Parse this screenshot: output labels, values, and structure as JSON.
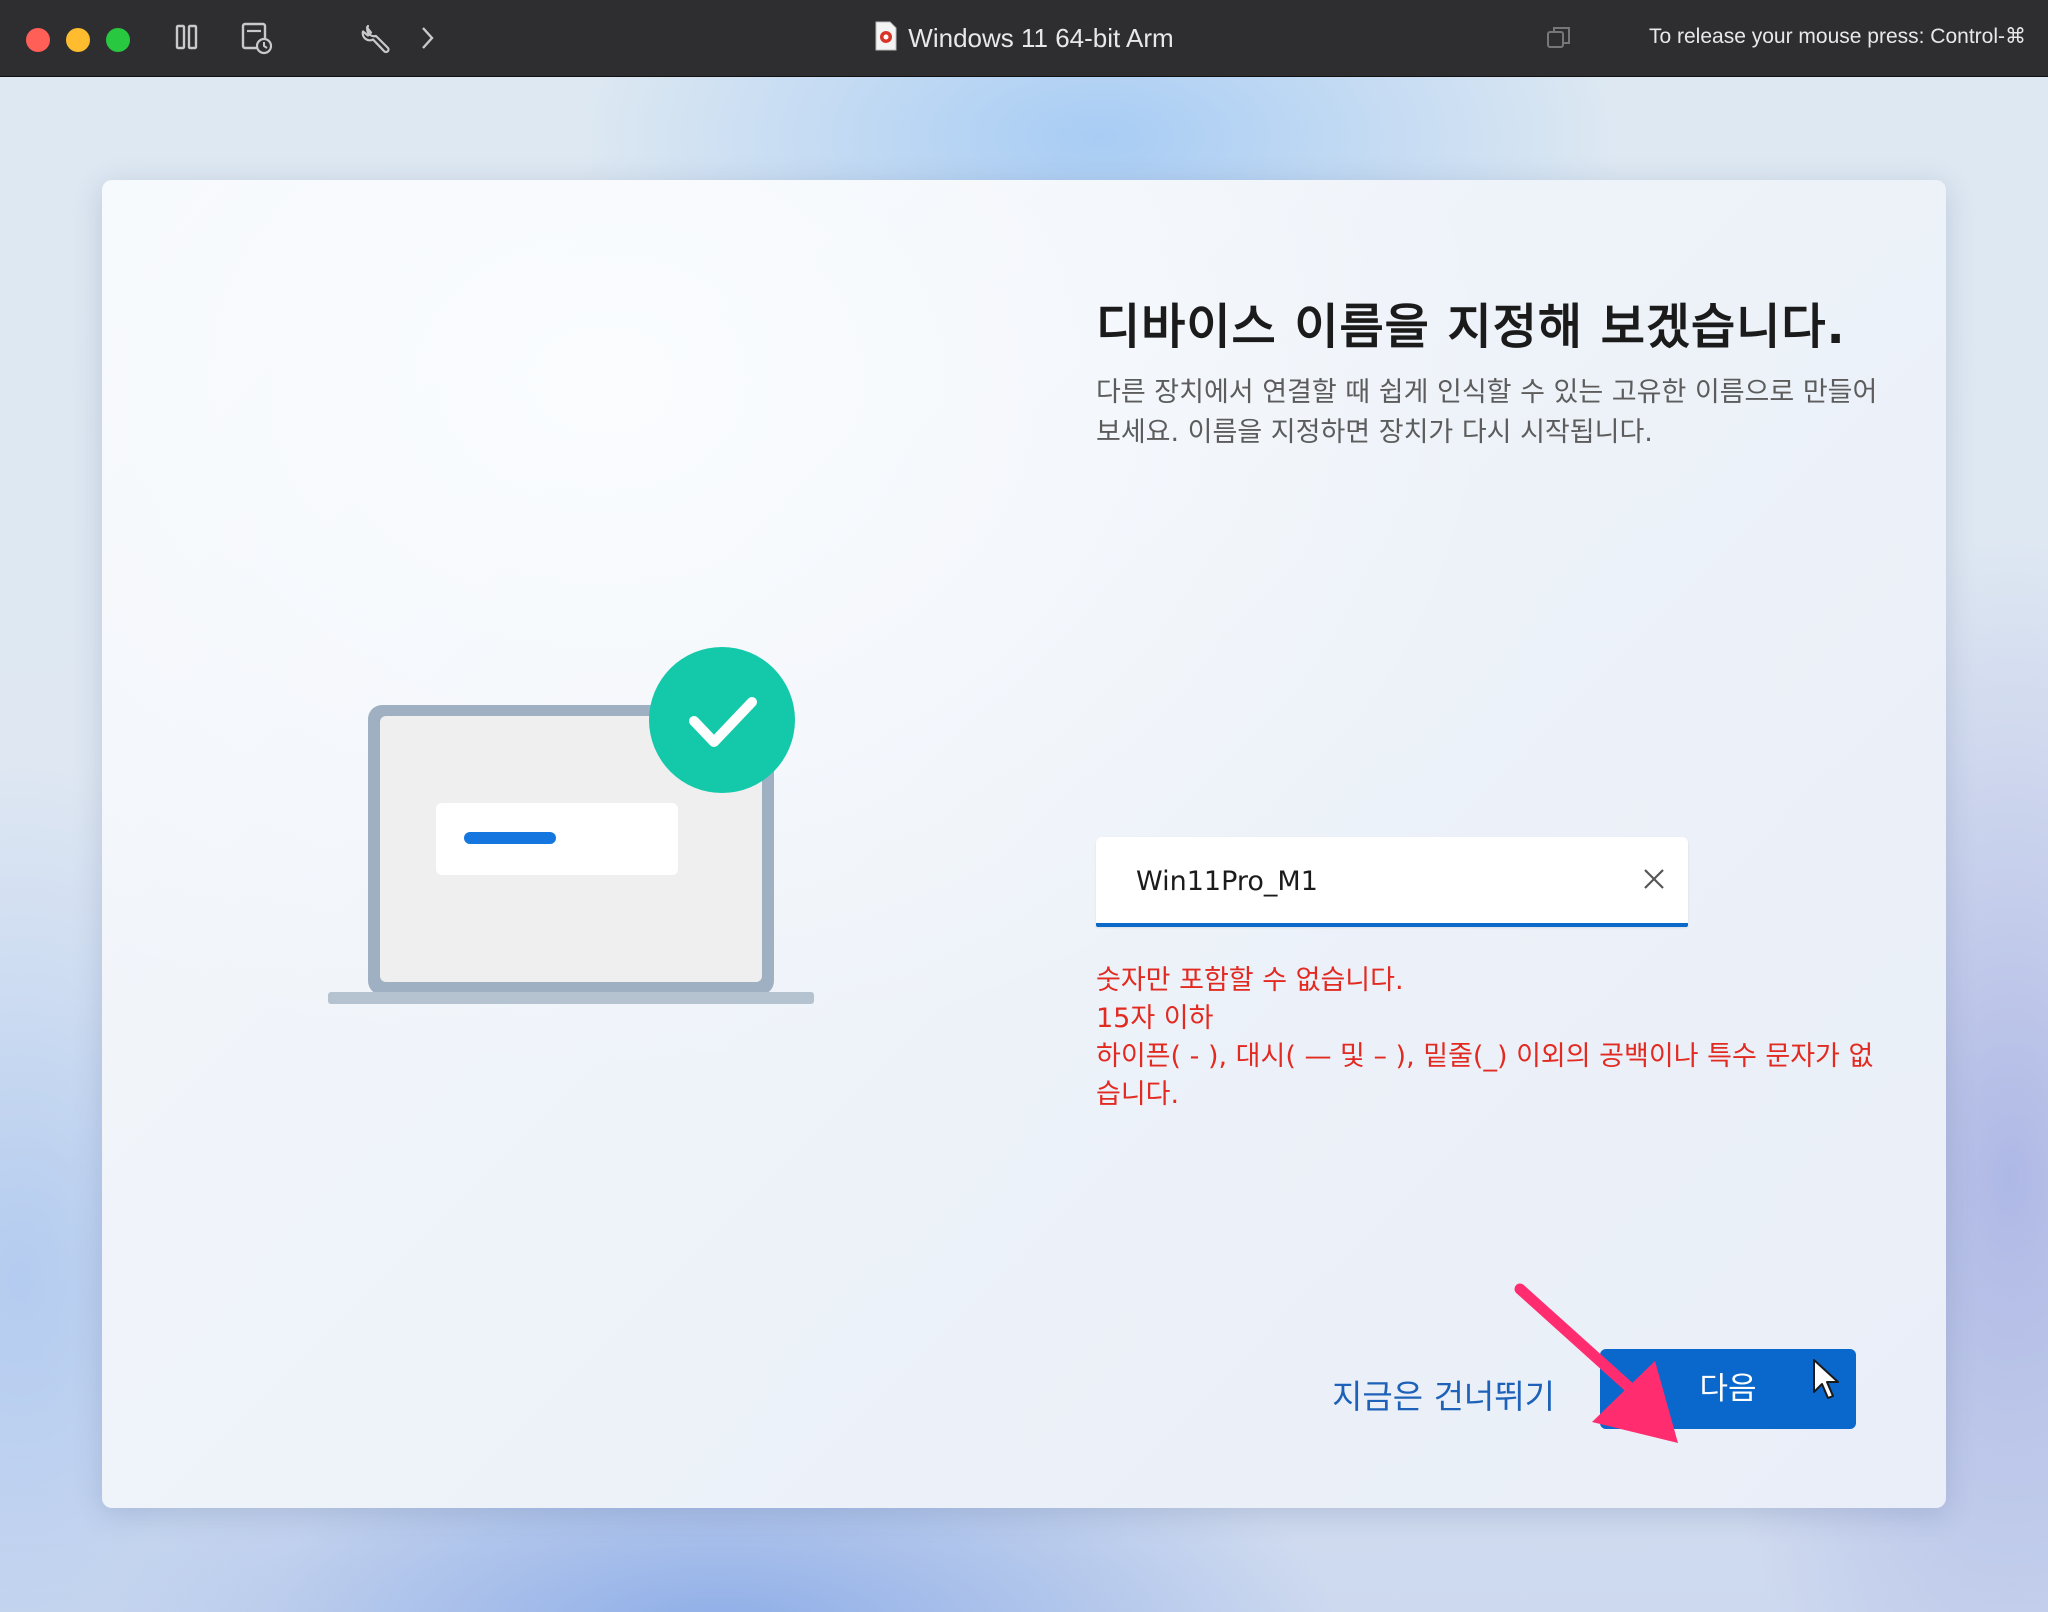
{
  "window": {
    "title": "Windows 11 64-bit Arm",
    "release_hint": "To release your mouse press: Control-⌘"
  },
  "toolbar": {
    "icons": [
      "pause-icon",
      "snapshot-icon",
      "settings-wrench-icon",
      "chevron-right-icon",
      "window-restore-icon"
    ]
  },
  "setup": {
    "heading": "디바이스 이름을 지정해 보겠습니다.",
    "description": "다른 장치에서 연결할 때 쉽게 인식할 수 있는 고유한 이름으로 만들어 보세요. 이름을 지정하면 장치가 다시 시작됩니다.",
    "device_name": "Win11Pro_M1",
    "errors": [
      "숫자만 포함할 수 없습니다.",
      "15자 이하",
      "하이픈( - ), 대시( — 및 – ), 밑줄(_) 이외의 공백이나 특수 문자가 없습니다."
    ],
    "skip_label": "지금은 건너뛰기",
    "next_label": "다음"
  },
  "colors": {
    "accent": "#0a67cc",
    "error": "#e22a21",
    "link": "#1d62b8",
    "check_badge": "#14c9a9",
    "annotation_arrow": "#ff2d6f"
  },
  "bottom_icons": [
    "accessibility-icon",
    "volume-icon"
  ]
}
